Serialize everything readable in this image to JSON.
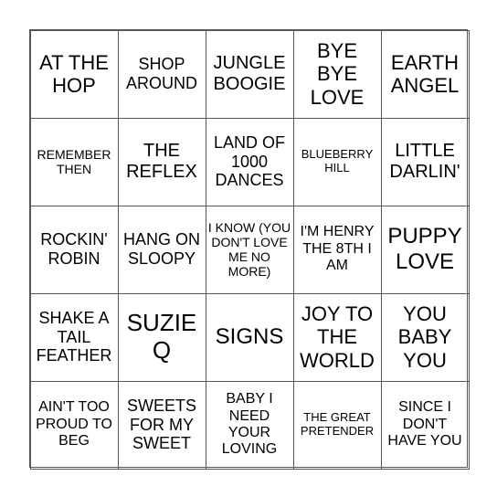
{
  "board": {
    "cells": [
      [
        "AT THE HOP",
        "SHOP AROUND",
        "JUNGLE BOOGIE",
        "BYE BYE LOVE",
        "EARTH ANGEL"
      ],
      [
        "REMEMBER THEN",
        "THE REFLEX",
        "LAND OF 1000 DANCES",
        "BLUEBERRY HILL",
        "LITTLE DARLIN'"
      ],
      [
        "ROCKIN' ROBIN",
        "HANG ON SLOOPY",
        "I KNOW (YOU DON'T LOVE ME NO MORE)",
        "I'M HENRY THE 8TH I AM",
        "PUPPY LOVE"
      ],
      [
        "SHAKE A TAIL FEATHER",
        "SUZIE Q",
        "SIGNS",
        "JOY TO THE WORLD",
        "YOU BABY YOU"
      ],
      [
        "AIN'T TOO PROUD TO BEG",
        "SWEETS FOR MY SWEET",
        "BABY I NEED YOUR LOVING",
        "THE GREAT PRETENDER",
        "SINCE I DON'T HAVE YOU"
      ]
    ]
  }
}
